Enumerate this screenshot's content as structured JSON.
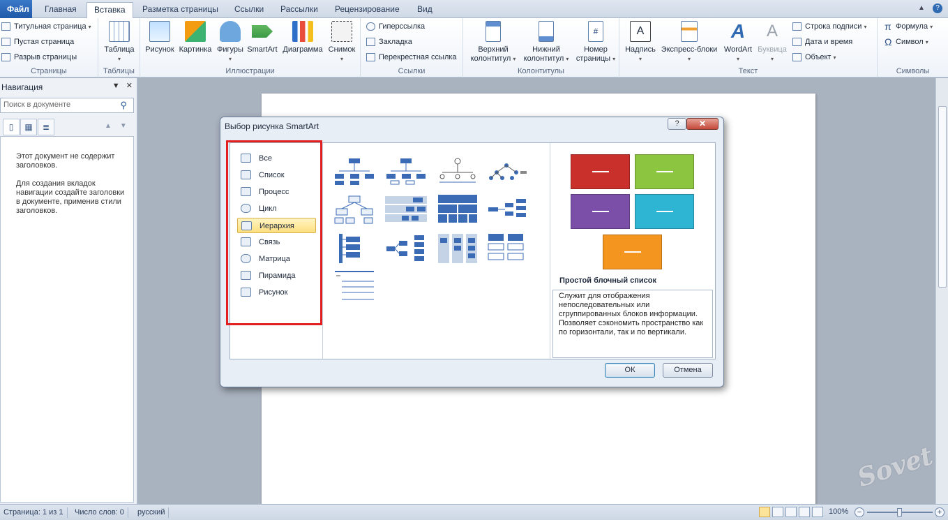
{
  "tabs": [
    "Файл",
    "Главная",
    "Вставка",
    "Разметка страницы",
    "Ссылки",
    "Рассылки",
    "Рецензирование",
    "Вид"
  ],
  "ribbon": {
    "pages": {
      "title_page": "Титульная страница",
      "blank_page": "Пустая страница",
      "page_break": "Разрыв страницы",
      "label": "Страницы"
    },
    "tables": {
      "table": "Таблица",
      "label": "Таблицы"
    },
    "illustrations": {
      "picture": "Рисунок",
      "clipart": "Картинка",
      "shapes": "Фигуры",
      "smartart": "SmartArt",
      "chart": "Диаграмма",
      "screenshot": "Снимок",
      "label": "Иллюстрации"
    },
    "links": {
      "hyperlink": "Гиперссылка",
      "bookmark": "Закладка",
      "crossref": "Перекрестная ссылка",
      "label": "Ссылки"
    },
    "headerfooter": {
      "header1": "Верхний",
      "header2": "колонтитул",
      "footer1": "Нижний",
      "footer2": "колонтитул",
      "pagenum1": "Номер",
      "pagenum2": "страницы",
      "label": "Колонтитулы"
    },
    "text": {
      "textbox": "Надпись",
      "quickparts": "Экспресс-блоки",
      "wordart": "WordArt",
      "dropcap": "Буквица",
      "signature": "Строка подписи",
      "datetime": "Дата и время",
      "object": "Объект",
      "label": "Текст"
    },
    "symbols": {
      "equation": "Формула",
      "symbol": "Символ",
      "label": "Символы"
    }
  },
  "nav": {
    "title": "Навигация",
    "search_placeholder": "Поиск в документе",
    "message1": "Этот документ не содержит заголовков.",
    "message2": "Для создания вкладок навигации создайте заголовки в документе, применив стили заголовков."
  },
  "dialog": {
    "title": "Выбор рисунка SmartArt",
    "help": "?",
    "categories": [
      "Все",
      "Список",
      "Процесс",
      "Цикл",
      "Иерархия",
      "Связь",
      "Матрица",
      "Пирамида",
      "Рисунок"
    ],
    "selected_category": "Иерархия",
    "preview_name": "Простой блочный список",
    "preview_desc": "Служит для отображения непоследовательных или сгруппированных блоков информации. Позволяет сэкономить пространство как по горизонтали, так и по вертикали.",
    "ok": "ОК",
    "cancel": "Отмена",
    "preview_colors": [
      "#c9302c",
      "#8cc53f",
      "#7b4fa8",
      "#2fb5d4",
      "#f3951e"
    ],
    "highlight_color": "#e32020"
  },
  "status": {
    "page": "Страница: 1 из 1",
    "words": "Число слов: 0",
    "lang": "русский",
    "zoom": "100%"
  },
  "watermark": "Sovet"
}
